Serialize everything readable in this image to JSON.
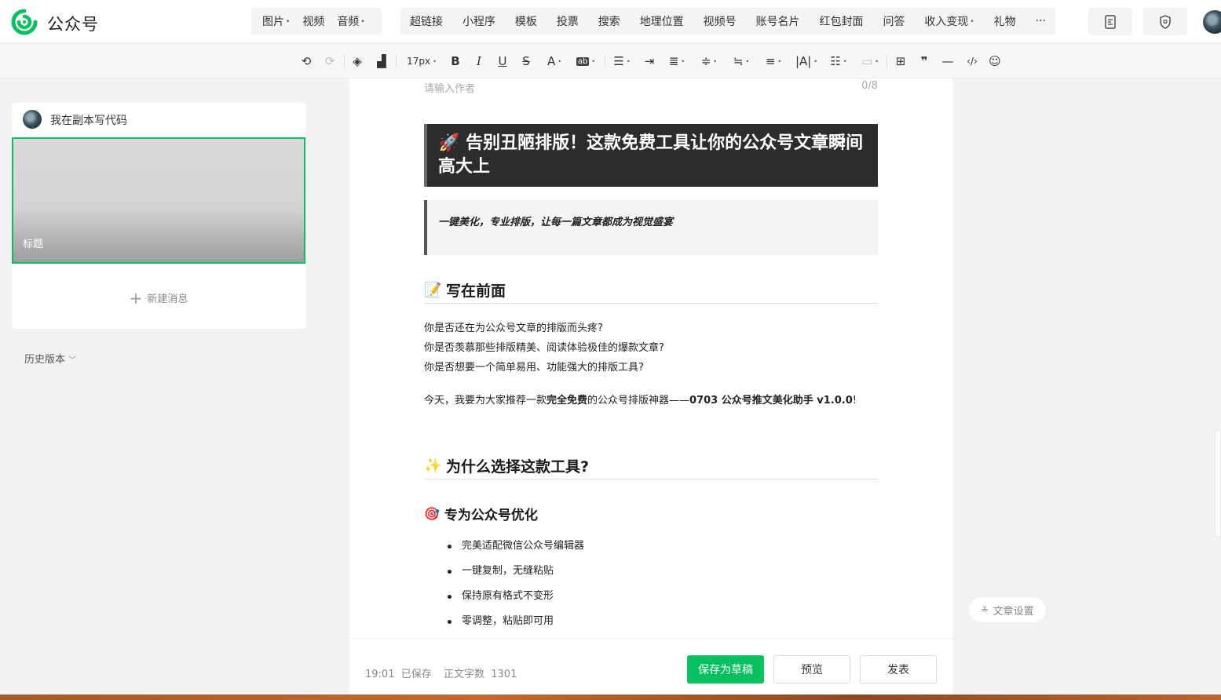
{
  "app": {
    "brand": "公众号"
  },
  "top_nav": {
    "group1": [
      {
        "label": "图片",
        "dropdown": true
      },
      {
        "label": "视频",
        "dropdown": false
      },
      {
        "label": "音频",
        "dropdown": true
      }
    ],
    "group2": [
      {
        "label": "超链接",
        "dropdown": false
      },
      {
        "label": "小程序",
        "dropdown": false
      },
      {
        "label": "模板",
        "dropdown": false
      },
      {
        "label": "投票",
        "dropdown": false
      },
      {
        "label": "搜索",
        "dropdown": false
      },
      {
        "label": "地理位置",
        "dropdown": false
      },
      {
        "label": "视频号",
        "dropdown": false
      },
      {
        "label": "账号名片",
        "dropdown": false
      },
      {
        "label": "红包封面",
        "dropdown": false
      },
      {
        "label": "问答",
        "dropdown": false
      },
      {
        "label": "收入变现",
        "dropdown": true
      },
      {
        "label": "礼物",
        "dropdown": false
      },
      {
        "label": "···",
        "dropdown": false
      }
    ]
  },
  "format_toolbar": {
    "font_size": "17px"
  },
  "sidebar": {
    "account_name": "我在副本写代码",
    "thumb_title": "标题",
    "new_message": "新建消息",
    "history": "历史版本"
  },
  "article": {
    "author_placeholder": "请输入作者",
    "author_count": "0/8",
    "hero_emoji": "🚀",
    "hero_title": "告别丑陋排版！这款免费工具让你的公众号文章瞬间高大上",
    "quote": "一键美化，专业排版，让每一篇文章都成为视觉盛宴",
    "section1": {
      "emoji": "📝",
      "title": "写在前面"
    },
    "lines": [
      "你是否还在为公众号文章的排版而头疼?",
      "你是否羡慕那些排版精美、阅读体验极佳的爆款文章?",
      "你是否想要一个简单易用、功能强大的排版工具?"
    ],
    "para2": {
      "prefix": "今天，我要为大家推荐一款",
      "bold1": "完全免费",
      "middle": "的公众号排版神器——",
      "bold2": "0703 公众号推文美化助手 v1.0.0",
      "suffix": "!"
    },
    "section2": {
      "emoji": "✨",
      "title": "为什么选择这款工具?"
    },
    "subsection": {
      "emoji": "🎯",
      "title": "专为公众号优化"
    },
    "bullets": [
      "完美适配微信公众号编辑器",
      "一键复制，无缝粘贴",
      "保持原有格式不变形",
      "零调整，粘贴即可用"
    ]
  },
  "footer": {
    "saved_status": "19:01  已保存",
    "word_count": "正文字数  1301",
    "save_draft": "保存为草稿",
    "preview": "预览",
    "publish": "发表"
  },
  "article_settings": "文章设置",
  "colors": {
    "primary_green": "#07c160",
    "hero_bg": "#2c2c2c",
    "quote_bg": "#f4f4f4"
  }
}
